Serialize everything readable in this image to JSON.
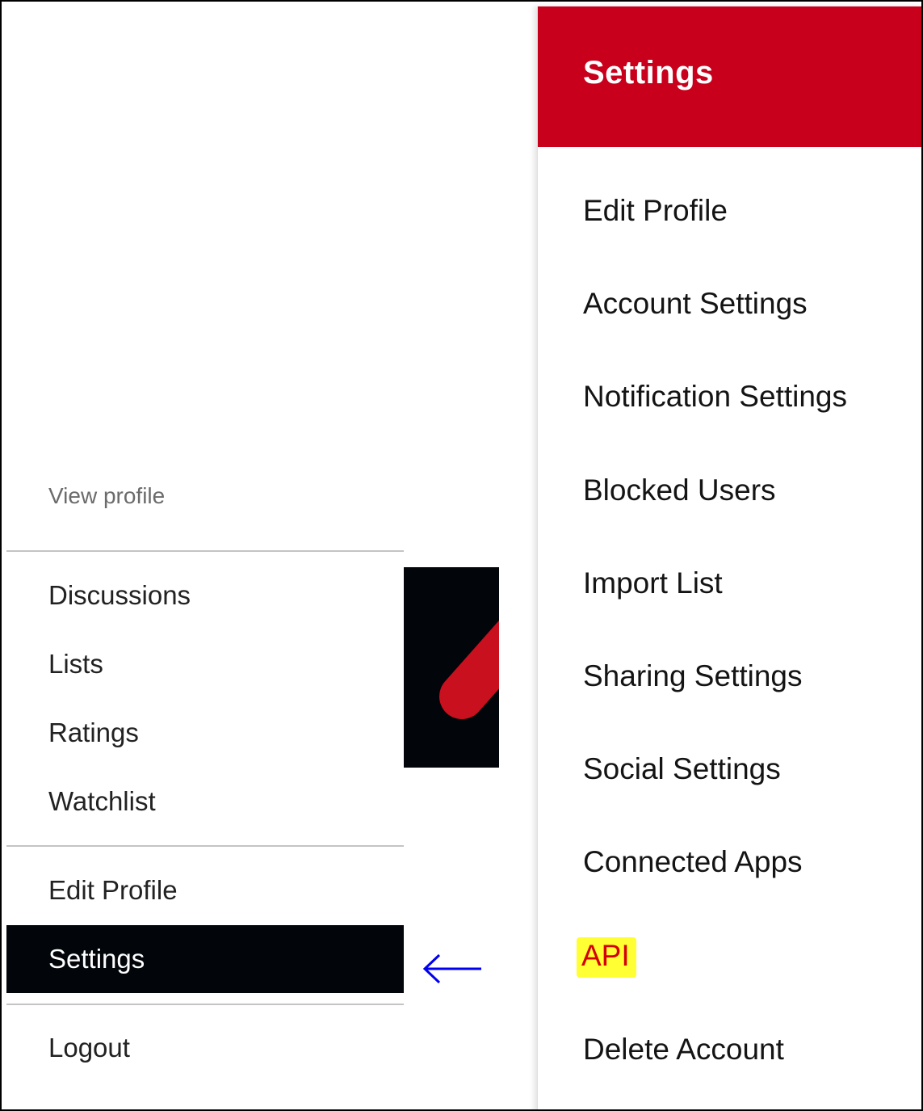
{
  "left_menu": {
    "view_profile": "View profile",
    "items": [
      {
        "label": "Discussions"
      },
      {
        "label": "Lists"
      },
      {
        "label": "Ratings"
      },
      {
        "label": "Watchlist"
      },
      {
        "label": "Edit Profile"
      },
      {
        "label": "Settings",
        "active": true
      },
      {
        "label": "Logout"
      }
    ]
  },
  "annotation": {
    "arrow_color": "#0000ee",
    "highlight_color": "#ffff33"
  },
  "settings_panel": {
    "title": "Settings",
    "header_color": "#c8001c",
    "items": [
      {
        "label": "Edit Profile"
      },
      {
        "label": "Account Settings"
      },
      {
        "label": "Notification Settings"
      },
      {
        "label": "Blocked Users"
      },
      {
        "label": "Import List"
      },
      {
        "label": "Sharing Settings"
      },
      {
        "label": "Social Settings"
      },
      {
        "label": "Connected Apps"
      },
      {
        "label": "API",
        "highlighted": true
      },
      {
        "label": "Delete Account"
      }
    ]
  }
}
